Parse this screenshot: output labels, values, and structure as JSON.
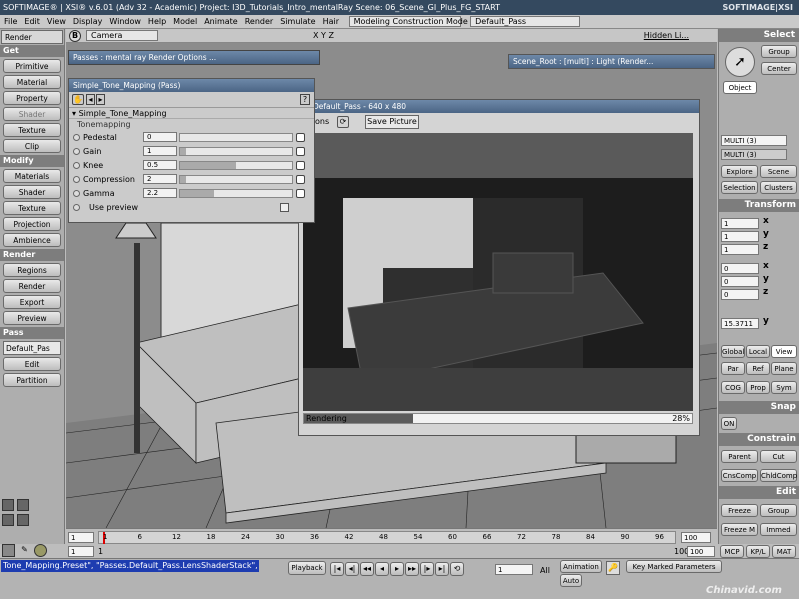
{
  "titlebar": {
    "app": "SOFTIMAGE® | XSI® v.6.01 (Adv 32 - Academic) Project: I3D_Tutorials_Intro_mentalRay    Scene: 06_Scene_GI_Plus_FG_START",
    "logo": "SOFTIMAGE|XSI"
  },
  "menu": [
    "File",
    "Edit",
    "View",
    "Display",
    "Window",
    "Help",
    "Model",
    "Animate",
    "Render",
    "Simulate",
    "Hair"
  ],
  "mode_combo": "Modeling Construction Mode",
  "pass_combo": "Default_Pass",
  "left_panel": {
    "mode": "Render",
    "get_header": "Get",
    "get_items": [
      "Primitive",
      "Material",
      "Property",
      "Shader",
      "Texture",
      "Clip"
    ],
    "modify_header": "Modify",
    "modify_items": [
      "Materials",
      "Shader",
      "Texture",
      "Projection",
      "Ambience"
    ],
    "render_header": "Render",
    "render_items": [
      "Regions",
      "Render",
      "Export",
      "Preview"
    ],
    "pass_header": "Pass",
    "pass_combo": "Default_Pas",
    "pass_items": [
      "Edit",
      "Partition"
    ]
  },
  "viewport": {
    "letter": "B",
    "camera": "Camera",
    "hidden": "Hidden Li...",
    "axes": "X Y Z"
  },
  "passes_window": {
    "title": "Passes : mental ray Render Options ..."
  },
  "scene_root_window": {
    "title": "Scene_Root : [multi] : Light (Render..."
  },
  "tone_window": {
    "title": "Simple_Tone_Mapping (Pass)",
    "section": "Simple_Tone_Mapping",
    "group": "Tonemapping",
    "params": [
      {
        "label": "Pedestal",
        "value": "0",
        "fill": 0
      },
      {
        "label": "Gain",
        "value": "1",
        "fill": 0.05
      },
      {
        "label": "Knee",
        "value": "0.5",
        "fill": 0.5
      },
      {
        "label": "Compression",
        "value": "2",
        "fill": 0.05
      },
      {
        "label": "Gamma",
        "value": "2.2",
        "fill": 0.3
      }
    ],
    "preview": "Use preview"
  },
  "render_window": {
    "title": "Default_Pass -  640 x 480",
    "toolbar_left": "ons",
    "save": "Save Picture",
    "status": "Rendering",
    "percent": "28%",
    "progress": 0.28
  },
  "right_panel": {
    "select": "Select",
    "group": "Group",
    "center": "Center",
    "object": "Object",
    "multi1": "MULTI (3)",
    "multi2": "MULTI (3)",
    "explore": "Explore",
    "scene": "Scene",
    "selection": "Selection",
    "clusters": "Clusters",
    "transform": "Transform",
    "scl": [
      "1",
      "1",
      "1"
    ],
    "rot": [
      "0",
      "0",
      "0"
    ],
    "pos_y": "15.3711",
    "axes": [
      "x",
      "y",
      "z"
    ],
    "global": "Global",
    "local": "Local",
    "view": "View",
    "par": "Par",
    "ref": "Ref",
    "plane": "Plane",
    "cog": "COG",
    "prop": "Prop",
    "sym": "Sym",
    "snap": "Snap",
    "on": "ON",
    "constrain": "Constrain",
    "parent": "Parent",
    "cut": "Cut",
    "cnscomp": "CnsComp",
    "childcomp": "ChldComp",
    "edit": "Edit",
    "freeze": "Freeze",
    "group2": "Group",
    "freezem": "Freeze M",
    "immed": "Immed",
    "mcp": "MCP",
    "kpl": "KP/L",
    "mat": "MAT"
  },
  "timeline": {
    "start": "1",
    "end": "100",
    "start2": "1",
    "end2": "100",
    "ticks": [
      "1",
      "6",
      "12",
      "18",
      "24",
      "30",
      "36",
      "42",
      "48",
      "54",
      "60",
      "66",
      "72",
      "78",
      "84",
      "90",
      "96"
    ],
    "current": "1"
  },
  "statusbar": {
    "script": "Tone_Mapping.Preset\", \"Passes.Default_Pass.LensShaderStack\", , False",
    "playback": "Playback",
    "frame": "1",
    "all": "All",
    "animation": "Animation",
    "auto": "Auto",
    "key_marked": "Key Marked Parameters",
    "watermark": "Chinavid.com"
  }
}
